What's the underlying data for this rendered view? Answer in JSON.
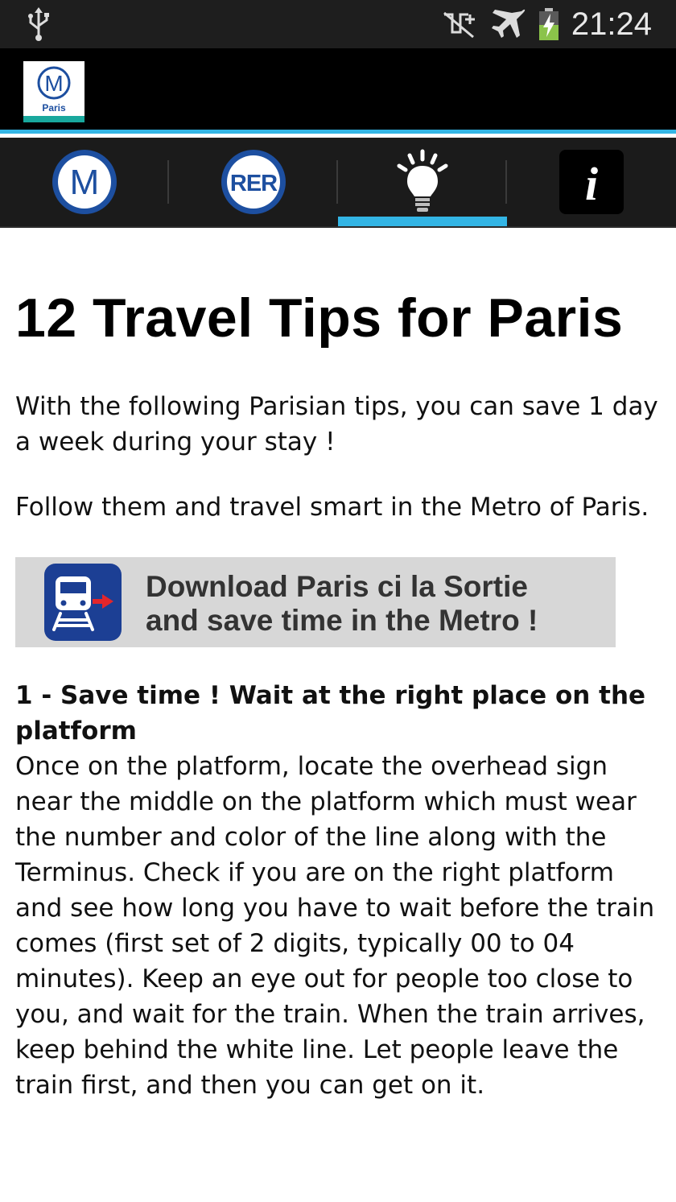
{
  "status_bar": {
    "time": "21:24",
    "icons": [
      "usb-icon",
      "no-signal-icon",
      "airplane-mode-icon",
      "battery-charging-icon"
    ]
  },
  "app": {
    "logo": {
      "icon": "paris-metro-logo",
      "letter": "M",
      "caption": "Paris"
    }
  },
  "tabs": [
    {
      "icon": "metro-icon",
      "label": "M",
      "active": false
    },
    {
      "icon": "rer-icon",
      "label": "RER",
      "active": false
    },
    {
      "icon": "lightbulb-icon",
      "label": "",
      "active": true
    },
    {
      "icon": "info-icon",
      "label": "i",
      "active": false
    }
  ],
  "content": {
    "title": "12 Travel Tips for Paris",
    "intro_1": "With the following Parisian tips, you can save 1 day a week during your stay !",
    "intro_2": "Follow them and travel smart in the Metro of Paris.",
    "banner": {
      "icon": "train-exit-icon",
      "line_1": "Download Paris ci la Sortie",
      "line_2": "and save time in the Metro !"
    },
    "tip_1": {
      "heading": "1 - Save time ! Wait at the right place on the platform",
      "body": "Once on the platform, locate the overhead sign near the middle on the platform which must wear the number and color of the line along with the Terminus. Check if you are on the right platform and see how long you have to wait before the train comes (first set of 2 digits, typically 00 to 04 minutes). Keep an eye out for people too close to you, and wait for the train. When the train arrives, keep behind the white line. Let people leave the train first, and then you can get on it."
    }
  },
  "colors": {
    "accent": "#33b5e5",
    "metro_blue": "#1d4fa0",
    "logo_teal": "#19a89d",
    "banner_bg": "#d7d7d7",
    "banner_icon_bg": "#1c3f94",
    "arrow_red": "#e3262b"
  }
}
